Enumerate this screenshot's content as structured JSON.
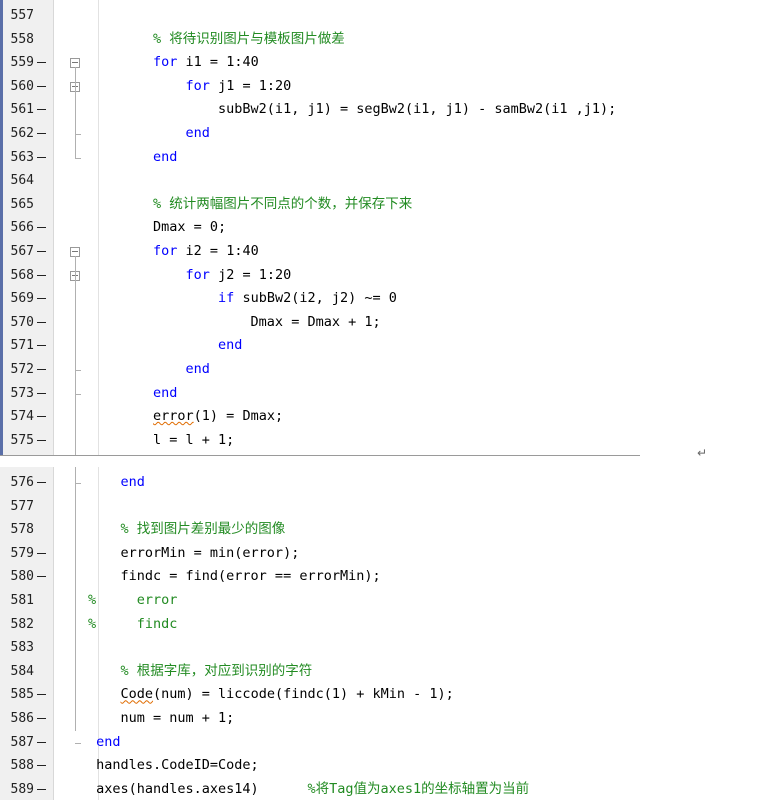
{
  "panel_top": {
    "lines": [
      {
        "n": "557",
        "bp": false,
        "code": ""
      },
      {
        "n": "558",
        "bp": false,
        "code": "        % 将待识别图片与模板图片做差",
        "type": "comment"
      },
      {
        "n": "559",
        "bp": true,
        "code": "        for i1 = 1:40",
        "fold": "open"
      },
      {
        "n": "560",
        "bp": true,
        "code": "            for j1 = 1:20",
        "fold": "open"
      },
      {
        "n": "561",
        "bp": true,
        "code": "                subBw2(i1, j1) = segBw2(i1, j1) - samBw2(i1 ,j1);"
      },
      {
        "n": "562",
        "bp": true,
        "code": "            end",
        "fold": "tick"
      },
      {
        "n": "563",
        "bp": true,
        "code": "        end",
        "fold": "tick"
      },
      {
        "n": "564",
        "bp": false,
        "code": ""
      },
      {
        "n": "565",
        "bp": false,
        "code": "        % 统计两幅图片不同点的个数，并保存下来",
        "type": "comment"
      },
      {
        "n": "566",
        "bp": true,
        "code": "        Dmax = 0;"
      },
      {
        "n": "567",
        "bp": true,
        "code": "        for i2 = 1:40",
        "fold": "open"
      },
      {
        "n": "568",
        "bp": true,
        "code": "            for j2 = 1:20",
        "fold": "open"
      },
      {
        "n": "569",
        "bp": true,
        "code": "                if subBw2(i2, j2) ~= 0"
      },
      {
        "n": "570",
        "bp": true,
        "code": "                    Dmax = Dmax + 1;"
      },
      {
        "n": "571",
        "bp": true,
        "code": "                end"
      },
      {
        "n": "572",
        "bp": true,
        "code": "            end",
        "fold": "tick"
      },
      {
        "n": "573",
        "bp": true,
        "code": "        end",
        "fold": "tick"
      },
      {
        "n": "574",
        "bp": true,
        "code": "        error(1) = Dmax;"
      },
      {
        "n": "575",
        "bp": true,
        "code": "        l = l + 1;"
      }
    ]
  },
  "panel_bottom": {
    "lines": [
      {
        "n": "576",
        "bp": true,
        "code": "    end",
        "fold": "tick"
      },
      {
        "n": "577",
        "bp": false,
        "code": ""
      },
      {
        "n": "578",
        "bp": false,
        "code": "    % 找到图片差别最少的图像",
        "type": "comment"
      },
      {
        "n": "579",
        "bp": true,
        "code": "    errorMin = min(error);"
      },
      {
        "n": "580",
        "bp": true,
        "code": "    findc = find(error == errorMin);"
      },
      {
        "n": "581",
        "bp": false,
        "code": "%     error",
        "type": "comment"
      },
      {
        "n": "582",
        "bp": false,
        "code": "%     findc",
        "type": "comment"
      },
      {
        "n": "583",
        "bp": false,
        "code": ""
      },
      {
        "n": "584",
        "bp": false,
        "code": "    % 根据字库，对应到识别的字符",
        "type": "comment"
      },
      {
        "n": "585",
        "bp": true,
        "code": "    Code(num) = liccode(findc(1) + kMin - 1);"
      },
      {
        "n": "586",
        "bp": true,
        "code": "    num = num + 1;"
      },
      {
        "n": "587",
        "bp": true,
        "code": " end",
        "fold": "tick"
      },
      {
        "n": "588",
        "bp": true,
        "code": " handles.CodeID=Code;"
      },
      {
        "n": "589",
        "bp": true,
        "code": " axes(handles.axes14)      %将Tag值为axes1的坐标轴置为当前"
      }
    ]
  },
  "colors": {
    "keyword": "#0000ff",
    "comment": "#228b22",
    "text": "#000000",
    "gutter": "#f0f0f0"
  },
  "icons": {
    "return": "return-arrow-icon",
    "fold": "fold-minus-icon"
  },
  "return_glyph": "↵"
}
